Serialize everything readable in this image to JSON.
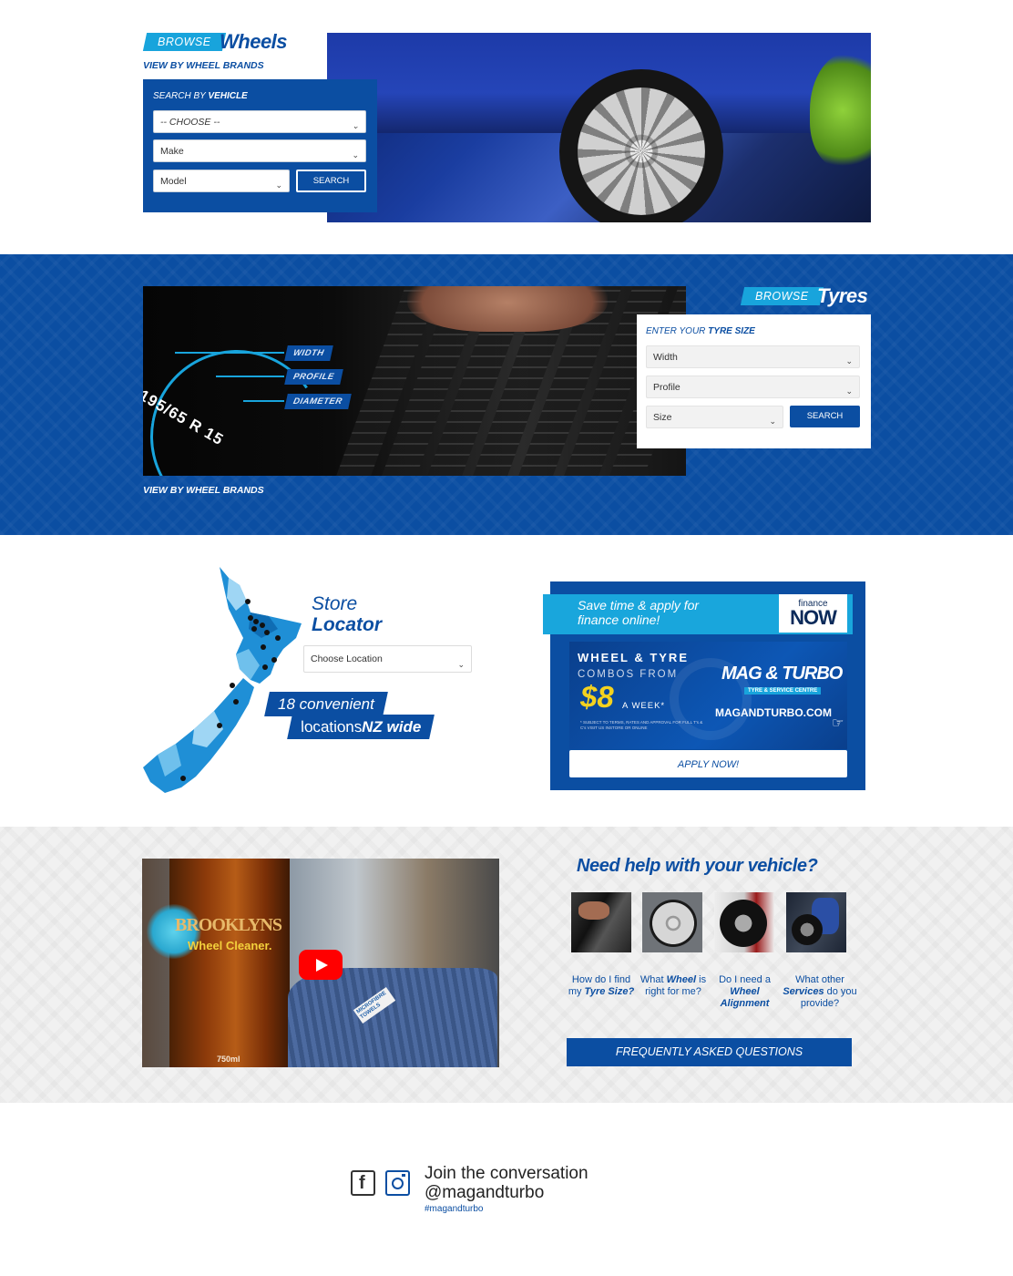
{
  "wheels": {
    "browse_label": "BROWSE",
    "title": "Wheels",
    "brands_link": "VIEW BY WHEEL BRANDS",
    "search_heading_prefix": "SEARCH BY ",
    "search_heading_bold": "VEHICLE",
    "choose_select": "-- CHOOSE --",
    "make_select": "Make",
    "model_select": "Model",
    "search_label": "SEARCH"
  },
  "tyres": {
    "browse_label": "BROWSE",
    "title": "Tyres",
    "size_heading_prefix": "ENTER YOUR ",
    "size_heading_bold": "TYRE SIZE",
    "width_select": "Width",
    "profile_select": "Profile",
    "size_select": "Size",
    "search_label": "SEARCH",
    "brands_link": "VIEW BY WHEEL BRANDS",
    "sidewall_text": "195/65 R 15",
    "dim_labels": [
      "WIDTH",
      "PROFILE",
      "DIAMETER"
    ]
  },
  "store": {
    "title_line1": "Store",
    "title_line2": "Locator",
    "location_select": "Choose Location",
    "chip_line1": "18 convenient",
    "chip_line2_prefix": "locations ",
    "chip_line2_bold": "NZ wide"
  },
  "finance_ad": {
    "strip_line1": "Save time & apply for",
    "strip_line2": "finance online!",
    "logo_small": "finance",
    "logo_big": "NOW",
    "combo_line1": "WHEEL & TYRE",
    "combo_line2": "COMBOS FROM",
    "price": "$8",
    "per_week": "A WEEK*",
    "fine_print": "* SUBJECT TO TERMS, RATES AND APPROVAL FOR FULL T's & C's VISIT US INSTORE OR ONLINE",
    "brand": "MAG & TURBO",
    "brand_sub": "TYRE & SERVICE CENTRE",
    "domain": "MAGANDTURBO.COM",
    "apply_label": "APPLY NOW!"
  },
  "video": {
    "bottle_brand": "BROOKLYNS",
    "bottle_product": "Wheel Cleaner.",
    "bottle_volume": "750ml",
    "towel_text": "MICROFIBRE TOWELS"
  },
  "help": {
    "title": "Need help with your vehicle?",
    "questions": [
      {
        "pre": "How do I find my ",
        "bold": "Tyre Size?",
        "post": ""
      },
      {
        "pre": "What ",
        "bold": "Wheel",
        "post": " is right for me?"
      },
      {
        "pre": "Do I need a ",
        "bold": "Wheel Alignment",
        "post": ""
      },
      {
        "pre": "What other ",
        "bold": "Services",
        "post": " do you provide?"
      }
    ],
    "faq_label": "FREQUENTLY ASKED QUESTIONS"
  },
  "social": {
    "line1": "Join the conversation",
    "line2": "@magandturbo",
    "hashtag": "#magandturbo"
  },
  "colors": {
    "brand_blue": "#0b4ea2",
    "accent_cyan": "#18a4dc",
    "youtube_red": "#ff0000"
  }
}
